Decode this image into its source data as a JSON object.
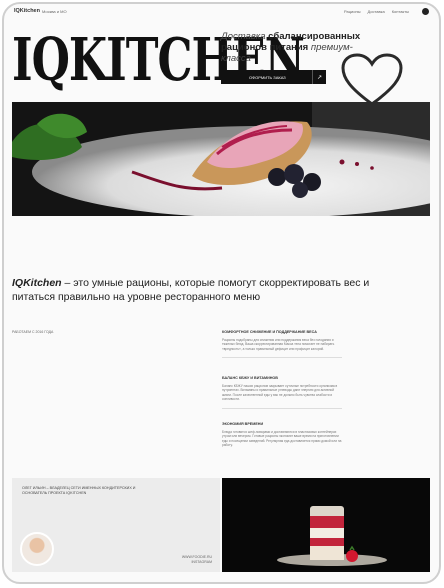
{
  "nav": {
    "logo": "IQKitchen",
    "city": "Москва и МО",
    "links": [
      "Рационы",
      "Доставка",
      "Контакты"
    ]
  },
  "hero": {
    "brand": "IQKITCHEN",
    "tagline_em": "Доставка",
    "tagline_line1_rest": " сбалансированных",
    "tagline_line2": "рационов питания ",
    "tagline_em2": "премиум-класса",
    "cta_label": "ОФОРМИТЬ ЗАКАЗ",
    "cta_arrow": "↗"
  },
  "intro": {
    "brand": "IQKitchen",
    "text": " – это умные рационы, которые помогут скорректировать вес и питаться правильно на уровне ресторанного меню"
  },
  "since": "РАБОТАЕМ С 2016 ГОДА",
  "features": [
    {
      "title": "КОМФОРТНОЕ СНИЖЕНИЕ И ПОДДЕРЖАНИЕ ВЕСА",
      "text": "Рационы подобраны для снижения или поддержания веса без голодания и тяжелых блюд. Ваша скорректированная Масса тела помогает не набирать «вредность», а только правильный дефицит или профицит калорий."
    },
    {
      "title": "БАЛАНС КБЖУ И ВИТАМИНОВ",
      "text": "Баланс КБЖУ наших рационов закрывает суточные потребности организма в нутриентах. Витамины и правильные углеводы дают энергию для активной жизни. После качественной еды у вас не должно быть чувства слабости и сонливости."
    },
    {
      "title": "ЭКОНОМИЯ ВРЕМЕНИ",
      "text": "Блюда готовятся шеф-поварами и доставляются в пластиковых контейнерах утром или вечером. Готовые рационы экономят ваше время на приготовлении еды и посещении заведений. Регулярная еда доставляется прямо домой или на работу."
    }
  ],
  "author": {
    "text": "ОЛЕГ ИЛЬИН – ВЛАДЕЛЕЦ СЕТИ ИМЕННЫХ КОНДИТЕРСКИХ И ОСНОВАТЕЛЬ ПРОЕКТА IQKITCHEN",
    "links": [
      "WWW.FOODIE.RU",
      "INSTAGRAM"
    ]
  }
}
